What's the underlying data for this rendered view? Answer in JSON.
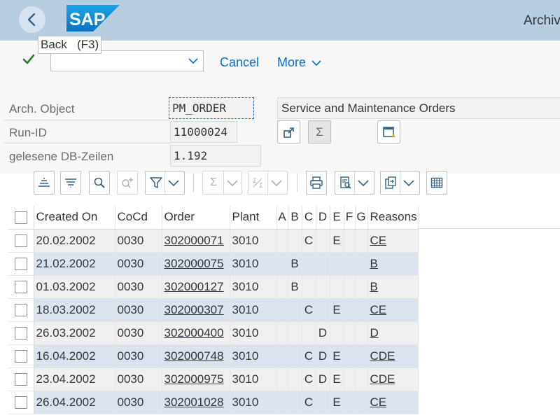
{
  "shell": {
    "title": "Archiv",
    "logo_text": "SAP",
    "back_tooltip": "Back   (F3)"
  },
  "toolbar": {
    "command_value": "",
    "cancel_label": "Cancel",
    "more_label": "More"
  },
  "header": {
    "arch_object_label": "Arch. Object",
    "arch_object_value": "PM_ORDER",
    "arch_object_desc": "Service and Maintenance Orders",
    "run_id_label": "Run-ID",
    "run_id_value": "11000024",
    "db_rows_label": "gelesene DB-Zeilen",
    "db_rows_value": "1.192",
    "sum_symbol": "Σ"
  },
  "grid": {
    "columns": [
      "Created On",
      "CoCd",
      "Order",
      "Plant",
      "A",
      "B",
      "C",
      "D",
      "E",
      "F",
      "G",
      "Reasons"
    ],
    "rows": [
      {
        "created": "20.02.2002",
        "cocd": "0030",
        "order": "302000071",
        "plant": "3010",
        "a": "",
        "b": "",
        "c": "C",
        "d": "",
        "e": "E",
        "f": "",
        "g": "",
        "reasons": "CE"
      },
      {
        "created": "21.02.2002",
        "cocd": "0030",
        "order": "302000075",
        "plant": "3010",
        "a": "",
        "b": "B",
        "c": "",
        "d": "",
        "e": "",
        "f": "",
        "g": "",
        "reasons": "B"
      },
      {
        "created": "01.03.2002",
        "cocd": "0030",
        "order": "302000127",
        "plant": "3010",
        "a": "",
        "b": "B",
        "c": "",
        "d": "",
        "e": "",
        "f": "",
        "g": "",
        "reasons": "B"
      },
      {
        "created": "18.03.2002",
        "cocd": "0030",
        "order": "302000307",
        "plant": "3010",
        "a": "",
        "b": "",
        "c": "C",
        "d": "",
        "e": "E",
        "f": "",
        "g": "",
        "reasons": "CE"
      },
      {
        "created": "26.03.2002",
        "cocd": "0030",
        "order": "302000400",
        "plant": "3010",
        "a": "",
        "b": "",
        "c": "",
        "d": "D",
        "e": "",
        "f": "",
        "g": "",
        "reasons": "D"
      },
      {
        "created": "16.04.2002",
        "cocd": "0030",
        "order": "302000748",
        "plant": "3010",
        "a": "",
        "b": "",
        "c": "C",
        "d": "D",
        "e": "E",
        "f": "",
        "g": "",
        "reasons": "CDE"
      },
      {
        "created": "23.04.2002",
        "cocd": "0030",
        "order": "302000975",
        "plant": "3010",
        "a": "",
        "b": "",
        "c": "C",
        "d": "D",
        "e": "E",
        "f": "",
        "g": "",
        "reasons": "CDE"
      },
      {
        "created": "26.04.2002",
        "cocd": "0030",
        "order": "302001028",
        "plant": "3010",
        "a": "",
        "b": "",
        "c": "C",
        "d": "",
        "e": "E",
        "f": "",
        "g": "",
        "reasons": "CE"
      }
    ]
  },
  "colors": {
    "shell_bg": "#b7cde0",
    "link": "#0a6ed1",
    "row_alt": "#dae3ee",
    "check_green": "#2b7d2b"
  },
  "icons": [
    "back-icon",
    "check-icon",
    "chevron-down-icon",
    "sort-ascending-icon",
    "sort-descending-icon",
    "search-icon",
    "search-next-icon",
    "filter-icon",
    "sum-icon",
    "subtotal-icon",
    "print-icon",
    "view-icon",
    "export-icon",
    "layout-icon"
  ]
}
